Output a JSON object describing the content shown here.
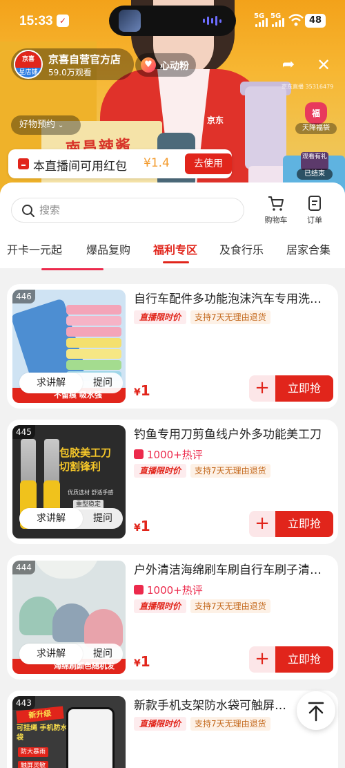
{
  "status_bar": {
    "time": "15:33",
    "battery": "48",
    "network": [
      "5G",
      "5G"
    ]
  },
  "live": {
    "store_name": "京喜自营官方店",
    "store_logo_top": "京喜",
    "store_logo_bottom": "星店铺",
    "views": "59.0万观看",
    "fan_label": "心动粉",
    "live_id": "京东直播 35316479",
    "goods_preview": "好物预约",
    "lucky_bag_label": "天降福袋",
    "lucky_bag_char": "福",
    "replay_thumb": "观看有礼",
    "replay_label": "已结束",
    "pack_text": "南昌辣酱",
    "vest_logo": "京东",
    "redpack": {
      "text": "本直播间可用红包",
      "amount": "¥1.4",
      "button": "去使用"
    }
  },
  "panel": {
    "search_placeholder": "搜索",
    "cart_label": "购物车",
    "orders_label": "订单",
    "tabs": [
      "开卡一元起",
      "爆品复购",
      "福利专区",
      "居家合集"
    ],
    "tab_partial": "及食行乐",
    "active_tab": "福利专区"
  },
  "products": [
    {
      "rank": "446",
      "title": "自行车配件多功能泡沫汽车专用洗车刷",
      "hot": "",
      "tag_limit": "直播限时价",
      "tag_return": "支持7天无理由退货",
      "currency": "¥",
      "price": "1",
      "ask": "求讲解",
      "question": "提问",
      "buy": "立即抢",
      "banner": "不留痕 吸水强"
    },
    {
      "rank": "445",
      "title": "钓鱼专用刀剪鱼线户外多功能美工刀",
      "hot": "1000+热评",
      "tag_limit": "直播限时价",
      "tag_return": "支持7天无理由退货",
      "currency": "¥",
      "price": "1",
      "ask": "求讲解",
      "question": "提问",
      "buy": "立即抢",
      "art_headline": "包胶美工刀 切割锋利",
      "art_sub": "优质选材 舒适手感",
      "art_badge": "重型稳定"
    },
    {
      "rank": "444",
      "title": "户外清洁海绵刷车刷自行车刷子清洁刷",
      "hot": "1000+热评",
      "tag_limit": "直播限时价",
      "tag_return": "支持7天无理由退货",
      "currency": "¥",
      "price": "1",
      "ask": "求讲解",
      "question": "提问",
      "buy": "立即抢",
      "banner": "海绵刷颜色随机发"
    },
    {
      "rank": "443",
      "title": "新款手机支架防水袋可触屏外卖骑手",
      "tag_limit": "直播限时价",
      "tag_return": "支持7天无理由退货",
      "art_new": "新升级",
      "art_caption": "可挂绳 手机防水袋",
      "art_badge1": "防大暴雨",
      "art_badge2": "触屏灵敏"
    }
  ],
  "colors": {
    "brand_red": "#e1251b",
    "accent_pink": "#ec2a4c",
    "return_orange": "#c46a1f",
    "redpack_amount": "#f39b2e"
  }
}
